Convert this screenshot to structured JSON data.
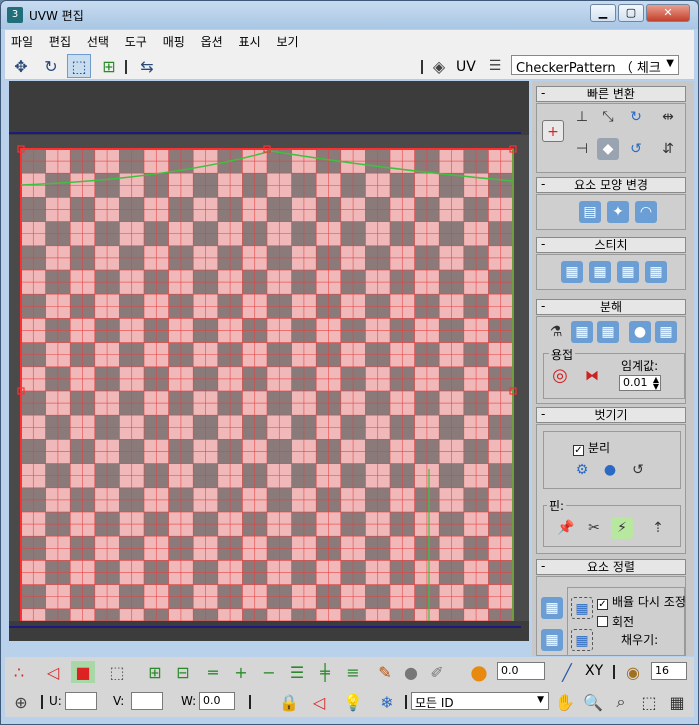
{
  "window": {
    "title": "UVW 편집",
    "app_icon": "3ds-max-icon"
  },
  "window_buttons": {
    "minimize": "▁",
    "maximize": "▢",
    "close": "✕"
  },
  "menu": [
    "파일",
    "편집",
    "선택",
    "도구",
    "매핑",
    "옵션",
    "표시",
    "보기"
  ],
  "toolbar": {
    "icons": [
      "move-icon",
      "rotate-icon",
      "scale-icon",
      "freeform-icon",
      "mirror-icon"
    ],
    "uv_label": "UV",
    "texture_select": "CheckerPattern （ 체크"
  },
  "panel": {
    "quick_transform": {
      "title": "빠른 변환"
    },
    "reshape": {
      "title": "요소 모양 변경"
    },
    "stitch": {
      "title": "스티치"
    },
    "explode": {
      "title": "분해",
      "weld_label": "용접",
      "threshold_label": "임계값:",
      "threshold_value": "0.01"
    },
    "peel": {
      "title": "벗기기",
      "detach_label": "분리",
      "detach_checked": true,
      "pins_label": "핀:"
    },
    "arrange": {
      "title": "요소 정렬",
      "rescale_label": "배율 다시 조정",
      "rescale_checked": true,
      "rotate_label": "회전",
      "rotate_checked": false,
      "fill_label": "채우기:"
    }
  },
  "bottom": {
    "value_field": "0.0",
    "xy_label": "XY",
    "count_field": "16",
    "u_label": "U:",
    "v_label": "V:",
    "w_label": "W:",
    "w_value": "0.0",
    "id_select": "모든 ID"
  },
  "colors": {
    "checker_dark": "#8a7a7a",
    "checker_light": "#f0b8b8",
    "grid_line": "#e84040",
    "seam": "#40c040",
    "border": "#ff3030"
  }
}
